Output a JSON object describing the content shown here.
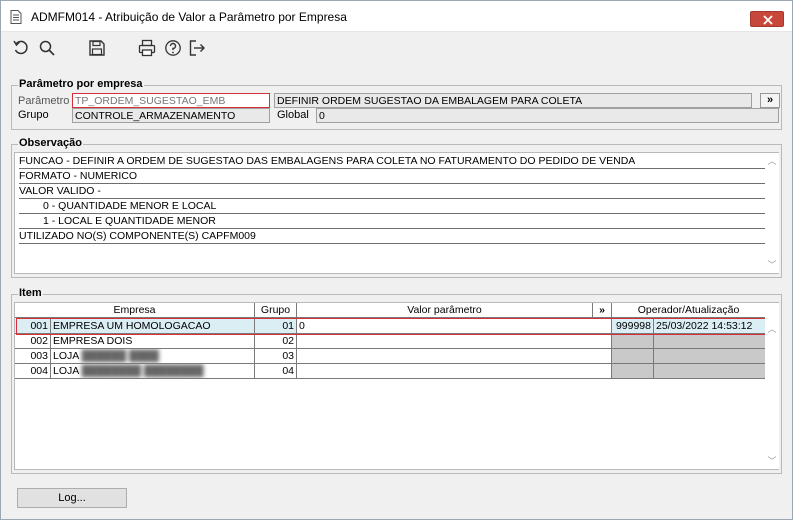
{
  "window": {
    "title": "ADMFM014 - Atribuição de Valor a Parâmetro por Empresa"
  },
  "toolbar": {
    "icons": [
      "undo-icon",
      "search-icon",
      "save-icon",
      "print-icon",
      "help-icon",
      "exit-icon"
    ]
  },
  "parametro": {
    "legend": "Parâmetro por empresa",
    "param_label": "Parâmetro",
    "param_value": "TP_ORDEM_SUGESTAO_EMB",
    "param_description": "DEFINIR ORDEM SUGESTAO DA EMBALAGEM PARA COLETA",
    "lookup_label": "»",
    "grupo_label": "Grupo",
    "grupo_value": "CONTROLE_ARMAZENAMENTO",
    "global_label": "Global",
    "global_value": "0"
  },
  "observacao": {
    "legend": "Observação",
    "lines": [
      "FUNCAO - DEFINIR A ORDEM DE SUGESTAO DAS EMBALAGENS PARA COLETA NO FATURAMENTO DO PEDIDO DE VENDA",
      "FORMATO - NUMERICO",
      "VALOR VALIDO -",
      "      0 - QUANTIDADE MENOR E LOCAL",
      "      1 - LOCAL E QUANTIDADE MENOR",
      "UTILIZADO NO(S) COMPONENTE(S) CAPFM009"
    ]
  },
  "item": {
    "legend": "Item",
    "headers": {
      "empresa": "Empresa",
      "grupo": "Grupo",
      "valor": "Valor parâmetro",
      "expand": "»",
      "operador": "Operador/Atualização"
    },
    "rows": [
      {
        "code": "001",
        "empresa": "EMPRESA UM HOMOLOGACAO",
        "grupo": "01",
        "valor": "0",
        "operador": "999998",
        "atualizacao": "25/03/2022 14:53:12",
        "selected": true
      },
      {
        "code": "002",
        "empresa": "EMPRESA DOIS",
        "grupo": "02",
        "valor": "",
        "operador": "",
        "atualizacao": ""
      },
      {
        "code": "003",
        "empresa": "LOJA ",
        "empresa_redacted": "██████ ████",
        "grupo": "03",
        "valor": "",
        "operador": "",
        "atualizacao": ""
      },
      {
        "code": "004",
        "empresa": "LOJA ",
        "empresa_redacted": "████████ ████████",
        "grupo": "04",
        "valor": "",
        "operador": "",
        "atualizacao": ""
      }
    ]
  },
  "footer": {
    "log_button": "Log..."
  },
  "colors": {
    "highlight_border": "#d8303b",
    "selected_row": "#dbeef4",
    "close_button": "#c8473b"
  }
}
